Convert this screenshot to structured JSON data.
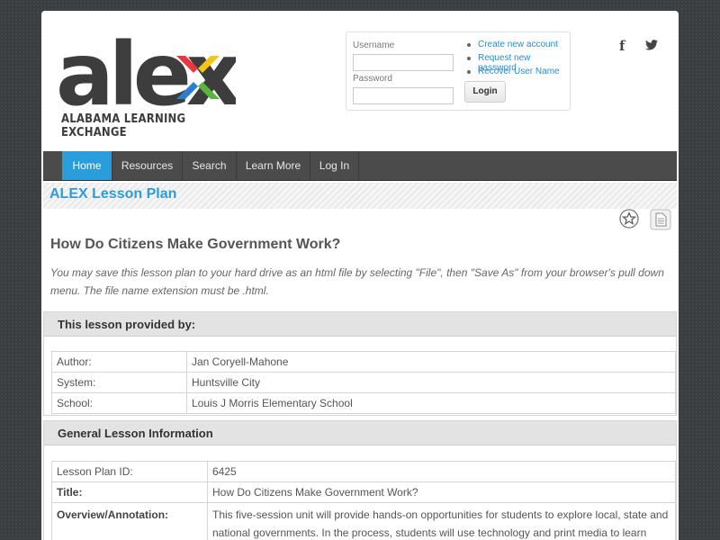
{
  "header": {
    "logo_text": "alex",
    "tagline": "ALABAMA LEARNING EXCHANGE",
    "brand_colors": {
      "red": "#e8373e",
      "yellow": "#f3c516",
      "blue": "#2c7fd0",
      "green": "#5bb43d"
    }
  },
  "login": {
    "username_label": "Username",
    "password_label": "Password",
    "login_button": "Login",
    "links": [
      "Create new account",
      "Request new password",
      "Recover User Name"
    ]
  },
  "social": {
    "facebook": "f",
    "twitter": "twitter-icon"
  },
  "nav": {
    "items": [
      "Home",
      "Resources",
      "Search",
      "Learn More",
      "Log In"
    ],
    "active": "Home"
  },
  "page": {
    "section_title": "ALEX Lesson Plan",
    "lesson_title": "How Do Citizens Make Government Work?",
    "save_note": "You may save this lesson plan to your hard drive as an html file by selecting \"File\", then \"Save As\" from your browser's pull down menu. The file name extension must be .html."
  },
  "provided_by": {
    "heading": "This lesson provided by:",
    "rows": [
      {
        "label": "Author:",
        "value": "Jan Coryell-Mahone"
      },
      {
        "label": "System:",
        "value": "Huntsville City"
      },
      {
        "label": "School:",
        "value": "Louis J Morris Elementary School"
      }
    ]
  },
  "general_info": {
    "heading": "General Lesson Information",
    "rows": [
      {
        "label": "Lesson Plan ID:",
        "value": "6425"
      },
      {
        "label": "Title:",
        "value": "How Do Citizens Make Government Work?"
      },
      {
        "label": "Overview/Annotation:",
        "value": "This five-session unit will provide hands-on opportunities for students to explore local, state and national governments. In the process, students will use technology and print media to learn about"
      }
    ]
  }
}
